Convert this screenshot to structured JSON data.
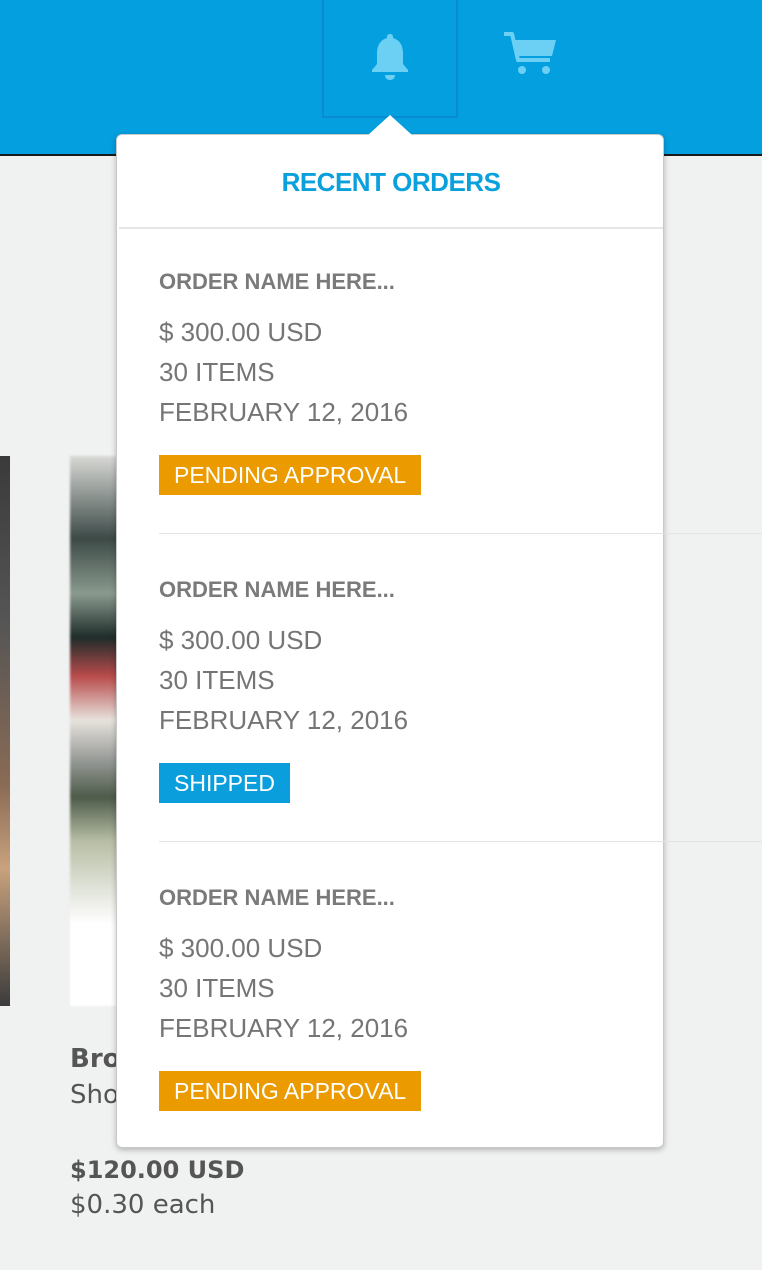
{
  "header": {
    "icons": [
      "bell-icon",
      "cart-icon"
    ],
    "color": "#049fdf"
  },
  "background_product": {
    "name": "Bro",
    "subtitle": "Sho",
    "price": "$120.00 USD",
    "unit_price": "$0.30 each"
  },
  "dropdown": {
    "title": "RECENT ORDERS",
    "orders": [
      {
        "name": "ORDER NAME HERE...",
        "amount": "$ 300.00 USD",
        "items": "30 ITEMS",
        "date": "FEBRUARY 12, 2016",
        "status": "PENDING APPROVAL",
        "status_color": "#eb9a00"
      },
      {
        "name": "ORDER NAME HERE...",
        "amount": "$ 300.00 USD",
        "items": "30 ITEMS",
        "date": "FEBRUARY 12, 2016",
        "status": "SHIPPED",
        "status_color": "#0a9edd"
      },
      {
        "name": "ORDER NAME HERE...",
        "amount": "$ 300.00 USD",
        "items": "30 ITEMS",
        "date": "FEBRUARY 12, 2016",
        "status": "PENDING APPROVAL",
        "status_color": "#eb9a00"
      }
    ]
  }
}
